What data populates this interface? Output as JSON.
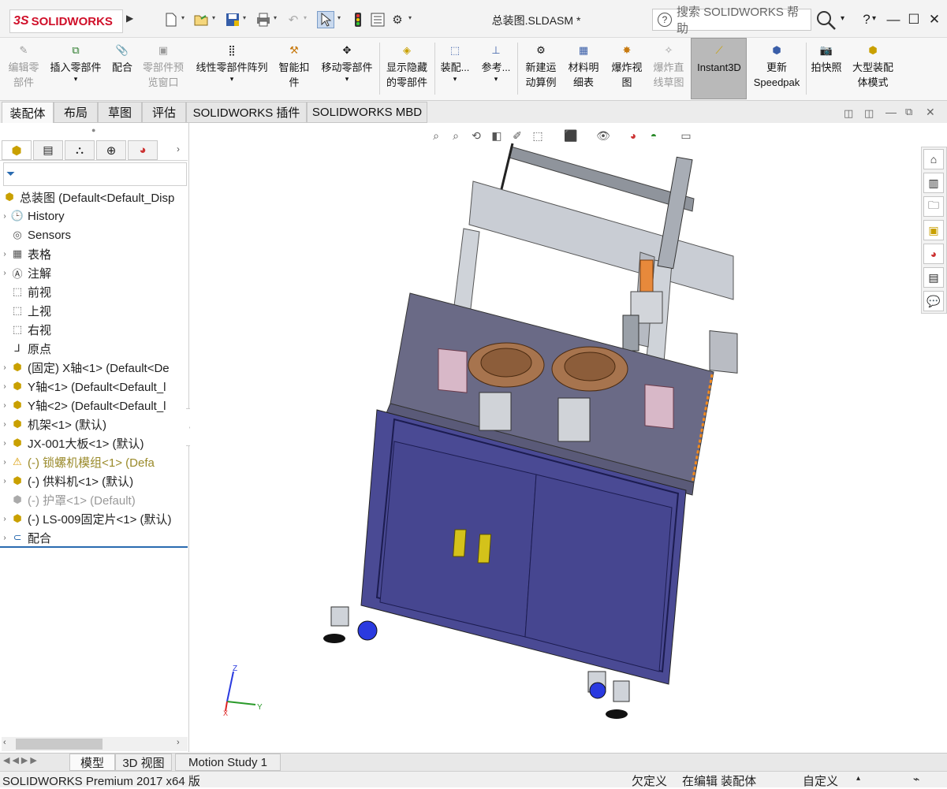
{
  "app": {
    "logo_prefix": "3S",
    "logo_text": "SOLIDWORKS",
    "document_title": "总装图.SLDASM *",
    "help_placeholder": "搜索 SOLIDWORKS 帮助"
  },
  "quick_access": [
    {
      "icon": "new-document-icon"
    },
    {
      "icon": "open-icon"
    },
    {
      "icon": "save-icon"
    },
    {
      "icon": "print-icon"
    },
    {
      "icon": "undo-icon"
    },
    {
      "icon": "select-icon"
    },
    {
      "icon": "rebuild-icon"
    },
    {
      "icon": "file-properties-icon"
    },
    {
      "icon": "options-icon"
    }
  ],
  "window_controls": {
    "help": "?",
    "minimize": "—",
    "maximize": "☐",
    "close": "✕"
  },
  "commands": [
    {
      "label": "编辑零\n部件",
      "disabled": true
    },
    {
      "label": "插入零部件",
      "disabled": false
    },
    {
      "label": "配合",
      "disabled": false
    },
    {
      "label": "零部件预\n览窗口",
      "disabled": true
    },
    {
      "label": "线性零部件阵列",
      "disabled": false
    },
    {
      "label": "智能扣\n件",
      "disabled": false
    },
    {
      "label": "移动零部件",
      "disabled": false
    },
    {
      "label": "显示隐藏\n的零部件",
      "disabled": false
    },
    {
      "label": "装配...",
      "disabled": false
    },
    {
      "label": "参考...",
      "disabled": false
    },
    {
      "label": "新建运\n动算例",
      "disabled": false
    },
    {
      "label": "材料明\n细表",
      "disabled": false
    },
    {
      "label": "爆炸视\n图",
      "disabled": false
    },
    {
      "label": "爆炸直\n线草图",
      "disabled": true
    },
    {
      "label": "Instant3D",
      "disabled": false
    },
    {
      "label": "更新\nSpeedpak",
      "disabled": false
    },
    {
      "label": "拍快照",
      "disabled": false
    },
    {
      "label": "大型装配\n体模式",
      "disabled": false
    }
  ],
  "tabs": [
    "装配体",
    "布局",
    "草图",
    "评估",
    "SOLIDWORKS 插件",
    "SOLIDWORKS MBD"
  ],
  "active_tab": "装配体",
  "feature_tree": {
    "root": "总装图 (Default<Default_Disp",
    "items": [
      {
        "label": "History",
        "expand": true,
        "icon": "history-icon",
        "style": "normal"
      },
      {
        "label": "Sensors",
        "expand": false,
        "icon": "sensor-icon",
        "style": "normal"
      },
      {
        "label": "表格",
        "expand": true,
        "icon": "table-icon",
        "style": "normal"
      },
      {
        "label": "注解",
        "expand": true,
        "icon": "annotation-icon",
        "style": "normal"
      },
      {
        "label": "前视",
        "expand": false,
        "icon": "plane-icon",
        "style": "normal"
      },
      {
        "label": "上视",
        "expand": false,
        "icon": "plane-icon",
        "style": "normal"
      },
      {
        "label": "右视",
        "expand": false,
        "icon": "plane-icon",
        "style": "normal"
      },
      {
        "label": "原点",
        "expand": false,
        "icon": "origin-icon",
        "style": "normal"
      },
      {
        "label": "(固定) X轴<1> (Default<De",
        "expand": true,
        "icon": "subassembly-icon",
        "style": "normal"
      },
      {
        "label": "Y轴<1> (Default<Default_l",
        "expand": true,
        "icon": "subassembly-icon",
        "style": "normal"
      },
      {
        "label": "Y轴<2> (Default<Default_l",
        "expand": true,
        "icon": "subassembly-icon",
        "style": "normal"
      },
      {
        "label": "机架<1> (默认)",
        "expand": true,
        "icon": "subassembly-icon",
        "style": "normal"
      },
      {
        "label": "JX-001大板<1> (默认)",
        "expand": true,
        "icon": "part-icon",
        "style": "normal"
      },
      {
        "label": "(-) 锁螺机模组<1> (Defa",
        "expand": true,
        "icon": "warning-icon",
        "style": "warn"
      },
      {
        "label": "(-) 供料机<1> (默认)",
        "expand": true,
        "icon": "subassembly-icon",
        "style": "normal"
      },
      {
        "label": "(-) 护罩<1> (Default)",
        "expand": false,
        "icon": "suppressed-part-icon",
        "style": "grey"
      },
      {
        "label": "(-) LS-009固定片<1> (默认)",
        "expand": true,
        "icon": "part-icon",
        "style": "normal"
      },
      {
        "label": "配合",
        "expand": true,
        "icon": "mates-icon",
        "style": "normal"
      }
    ]
  },
  "bottom_tabs": [
    "模型",
    "3D 视图",
    "Motion Study 1"
  ],
  "active_bottom_tab": "模型",
  "status": {
    "product": "SOLIDWORKS Premium 2017 x64 版",
    "state1": "欠定义",
    "state2": "在编辑 装配体",
    "state3": "自定义"
  },
  "triad": {
    "z": "Z",
    "y": "Y",
    "x": "X"
  }
}
